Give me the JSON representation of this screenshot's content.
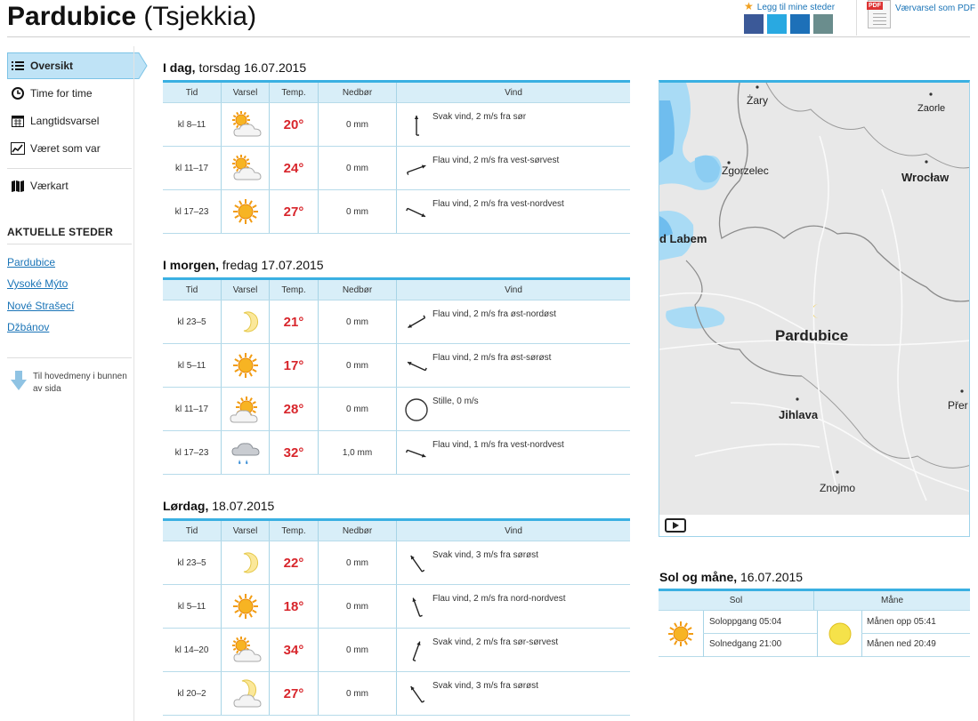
{
  "header": {
    "city": "Pardubice",
    "country": "(Tsjekkia)",
    "favorite_link": "Legg til mine steder",
    "pdf_link": "Værvarsel som PDF",
    "share_colors": [
      "#3b5998",
      "#29a9e1",
      "#1d70b8",
      "#6a8d8d"
    ]
  },
  "sidebar": {
    "nav": [
      {
        "label": "Oversikt",
        "icon": "list-icon",
        "active": true
      },
      {
        "label": "Time for time",
        "icon": "clock-icon"
      },
      {
        "label": "Langtidsvarsel",
        "icon": "calendar-icon"
      },
      {
        "label": "Været som var",
        "icon": "chart-icon"
      },
      {
        "label": "Værkart",
        "icon": "map-icon"
      }
    ],
    "places_title": "AKTUELLE STEDER",
    "places": [
      "Pardubice",
      "Vysoké Mýto",
      "Nové Strašecí",
      "Džbánov"
    ],
    "back_link": "Til hovedmeny i bunnen av sida"
  },
  "table_headers": {
    "tid": "Tid",
    "varsel": "Varsel",
    "temp": "Temp.",
    "nedbor": "Nedbør",
    "vind": "Vind"
  },
  "days": [
    {
      "head_bold": "I dag,",
      "head_rest": " torsdag 16.07.2015",
      "rows": [
        {
          "tid": "kl 8–11",
          "symbol": "partly-cloudy",
          "temp": "20°",
          "nedbor": "0 mm",
          "wind_dir_deg": 180,
          "vind": "Svak vind, 2 m/s fra sør"
        },
        {
          "tid": "kl 11–17",
          "symbol": "partly-cloudy",
          "temp": "24°",
          "nedbor": "0 mm",
          "wind_dir_deg": 250,
          "vind": "Flau vind, 2 m/s fra vest-sørvest"
        },
        {
          "tid": "kl 17–23",
          "symbol": "sun",
          "temp": "27°",
          "nedbor": "0 mm",
          "wind_dir_deg": 295,
          "vind": "Flau vind, 2 m/s fra vest-nordvest"
        }
      ]
    },
    {
      "head_bold": "I morgen,",
      "head_rest": " fredag 17.07.2015",
      "rows": [
        {
          "tid": "kl 23–5",
          "symbol": "moon",
          "temp": "21°",
          "nedbor": "0 mm",
          "wind_dir_deg": 60,
          "vind": "Flau vind, 2 m/s fra øst-nordøst"
        },
        {
          "tid": "kl 5–11",
          "symbol": "sun",
          "temp": "17°",
          "nedbor": "0 mm",
          "wind_dir_deg": 115,
          "vind": "Flau vind, 2 m/s fra øst-sørøst"
        },
        {
          "tid": "kl 11–17",
          "symbol": "fair",
          "temp": "28°",
          "nedbor": "0 mm",
          "wind_dir_deg": null,
          "vind": "Stille, 0 m/s"
        },
        {
          "tid": "kl 17–23",
          "symbol": "rain",
          "temp": "32°",
          "nedbor": "1,0 mm",
          "wind_dir_deg": 290,
          "vind": "Flau vind, 1 m/s fra vest-nordvest"
        }
      ]
    },
    {
      "head_bold": "Lørdag,",
      "head_rest": " 18.07.2015",
      "rows": [
        {
          "tid": "kl 23–5",
          "symbol": "moon",
          "temp": "22°",
          "nedbor": "0 mm",
          "wind_dir_deg": 145,
          "vind": "Svak vind, 3 m/s fra sørøst"
        },
        {
          "tid": "kl 5–11",
          "symbol": "sun",
          "temp": "18°",
          "nedbor": "0 mm",
          "wind_dir_deg": 160,
          "vind": "Flau vind, 2 m/s fra nord-nordvest"
        },
        {
          "tid": "kl 14–20",
          "symbol": "partly-cloudy",
          "temp": "34°",
          "nedbor": "0 mm",
          "wind_dir_deg": 200,
          "vind": "Svak vind, 2 m/s fra sør-sørvest"
        },
        {
          "tid": "kl 20–2",
          "symbol": "moon-cloud",
          "temp": "27°",
          "nedbor": "0 mm",
          "wind_dir_deg": 145,
          "vind": "Svak vind, 3 m/s fra sørøst"
        }
      ]
    }
  ],
  "map": {
    "cities": [
      {
        "name": "Żary",
        "size": "sm"
      },
      {
        "name": "Zaorle",
        "size": "sm"
      },
      {
        "name": "Zgorzelec",
        "size": "sm"
      },
      {
        "name": "Wrocław",
        "size": "md"
      },
      {
        "name": "d Labem",
        "size": "md"
      },
      {
        "name": "Pardubice",
        "size": "big"
      },
      {
        "name": "Jihlava",
        "size": "md"
      },
      {
        "name": "Přer",
        "size": "sm"
      },
      {
        "name": "Znojmo",
        "size": "sm"
      }
    ]
  },
  "sun_moon": {
    "head_bold": "Sol og måne,",
    "head_rest": " 16.07.2015",
    "sol_label": "Sol",
    "mane_label": "Måne",
    "sunrise": "Soloppgang 05:04",
    "sunset": "Solnedgang 21:00",
    "moonrise": "Månen opp 05:41",
    "moonset": "Månen ned 20:49"
  }
}
